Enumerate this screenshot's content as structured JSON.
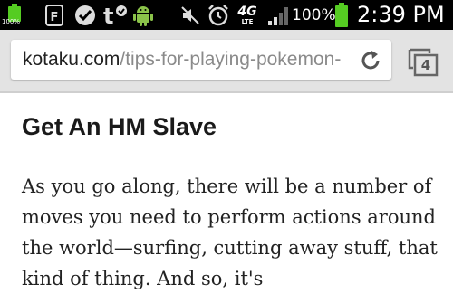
{
  "status_bar": {
    "battery_small_label": "100%",
    "battery_percent": "100%",
    "time": "2:39 PM",
    "network": "4G",
    "network_sub": "LTE",
    "icons": [
      "battery-icon",
      "flipboard-icon",
      "check-circle-icon",
      "tumblr-icon",
      "android-icon",
      "mute-icon",
      "alarm-icon",
      "wifi-4g-icon",
      "signal-icon",
      "battery-icon"
    ]
  },
  "browser": {
    "url_domain": "kotaku.com",
    "url_path": "/tips-for-playing-pokemon-",
    "tab_count": "4"
  },
  "article": {
    "heading": "Get An HM Slave",
    "paragraph": "As you go along, there will be a number of moves you need to perform actions around the world—surfing, cutting away stuff, that kind of thing. And so, it's"
  },
  "colors": {
    "status_bg": "#000000",
    "battery_green": "#55cc22",
    "toolbar_bg": "#e3e3e3"
  }
}
